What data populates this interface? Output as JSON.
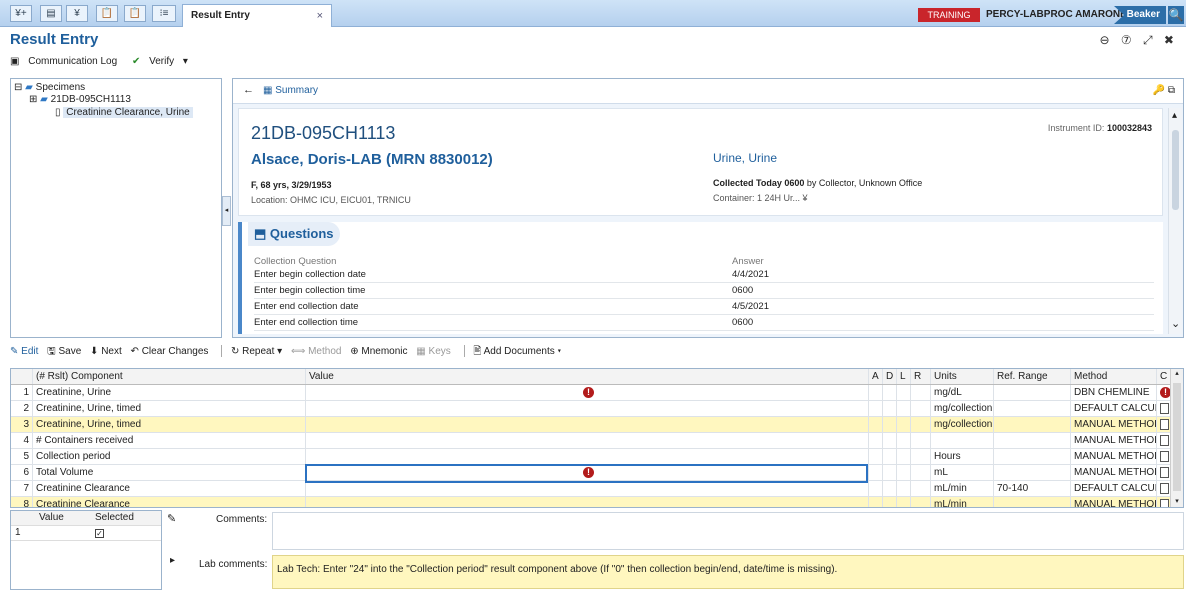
{
  "topbar": {
    "buttons": [
      "¥+",
      "▤",
      "¥",
      "📋",
      "📋",
      "⁝≡"
    ],
    "active_tab": "Result Entry",
    "tab_close": "×",
    "training": "TRAINING",
    "user": "PERCY-LABPROC AMARONE",
    "app": "Beaker",
    "search": "🔍"
  },
  "header": {
    "title": "Result Entry",
    "controls": "⊖ ⑦ ⤢ ✖",
    "communication_log": "Communication Log",
    "verify": "Verify",
    "verify_caret": "▾"
  },
  "tree": {
    "root_expander": "⊟",
    "root": "Specimens",
    "child_expander": "⊞",
    "specimen": "21DB-095CH1113",
    "test": "Creatinine Clearance, Urine",
    "collapse_arrow": "◂"
  },
  "summary": {
    "back": "←",
    "tab": "Summary",
    "tools": "🔑  ⧉",
    "specimen_id": "21DB-095CH1113",
    "instrument_label": "Instrument ID: ",
    "instrument_id": "100032843",
    "patient": "Alsace, Doris-LAB (MRN 8830012)",
    "source": "Urine, Urine",
    "demographics": "F, 68 yrs, 3/29/1953",
    "location": "Location: OHMC ICU, EICU01, TRNICU",
    "collected_strong": "Collected Today 0600",
    "collected_rest": " by Collector, Unknown Office",
    "container": "Container: 1 24H Ur...  ¥",
    "scroll_up": "▴",
    "scroll_down": "⌄"
  },
  "questions": {
    "title": "Questions",
    "header_question": "Collection Question",
    "header_answer": "Answer",
    "rows": [
      {
        "q": "Enter begin collection date",
        "a": "4/4/2021"
      },
      {
        "q": "Enter begin collection time",
        "a": "0600"
      },
      {
        "q": "Enter end collection date",
        "a": "4/5/2021"
      },
      {
        "q": "Enter end collection time",
        "a": "0600"
      }
    ]
  },
  "toolbar2": {
    "edit": "✎ Edit",
    "save": "🖫 Save",
    "next": "⬇ Next",
    "clear": "↶ Clear Changes",
    "repeat": "↻ Repeat ▾",
    "method": "⟺ Method",
    "mnemonic": "⊕ Mnemonic",
    "keys": "▦ Keys",
    "add_docs": "🖹 Add Documents ▾"
  },
  "grid": {
    "headers": {
      "component": "(# Rslt) Component",
      "value": "Value",
      "a": "A",
      "d": "D",
      "l": "L",
      "r": "R",
      "units": "Units",
      "ref": "Ref. Range",
      "method": "Method",
      "c": "C"
    },
    "rows": [
      {
        "num": "1",
        "component": "Creatinine, Urine",
        "units": "mg/dL",
        "ref": "",
        "method": "DBN CHEMLINE"
      },
      {
        "num": "2",
        "component": "Creatinine, Urine, timed",
        "units": "mg/collection",
        "ref": "",
        "method": "DEFAULT CALCUL"
      },
      {
        "num": "3",
        "component": "Creatinine, Urine, timed",
        "units": "mg/collection",
        "ref": "",
        "method": "MANUAL METHOD"
      },
      {
        "num": "4",
        "component": "# Containers received",
        "units": "",
        "ref": "",
        "method": "MANUAL METHOD"
      },
      {
        "num": "5",
        "component": "Collection period",
        "units": "Hours",
        "ref": "",
        "method": "MANUAL METHOD"
      },
      {
        "num": "6",
        "component": "Total Volume",
        "units": "mL",
        "ref": "",
        "method": "MANUAL METHOD"
      },
      {
        "num": "7",
        "component": "Creatinine Clearance",
        "units": "mL/min",
        "ref": "70-140",
        "method": "DEFAULT CALCUL"
      },
      {
        "num": "8",
        "component": "Creatinine Clearance",
        "units": "mL/min",
        "ref": "",
        "method": "MANUAL METHOD"
      }
    ],
    "error_glyph": "!",
    "scroll_up": "▴",
    "scroll_down": "▾"
  },
  "bottom": {
    "value_header": "Value",
    "selected_header": "Selected",
    "pencil": "✎",
    "row_num": "1",
    "check": "✓",
    "expander": "▸",
    "comments_label": "Comments:",
    "lab_label": "Lab comments:",
    "lab_text": "Lab Tech: Enter \"24\" into the \"Collection period\" result component above (If \"0\" then collection begin/end, date/time is missing)."
  }
}
